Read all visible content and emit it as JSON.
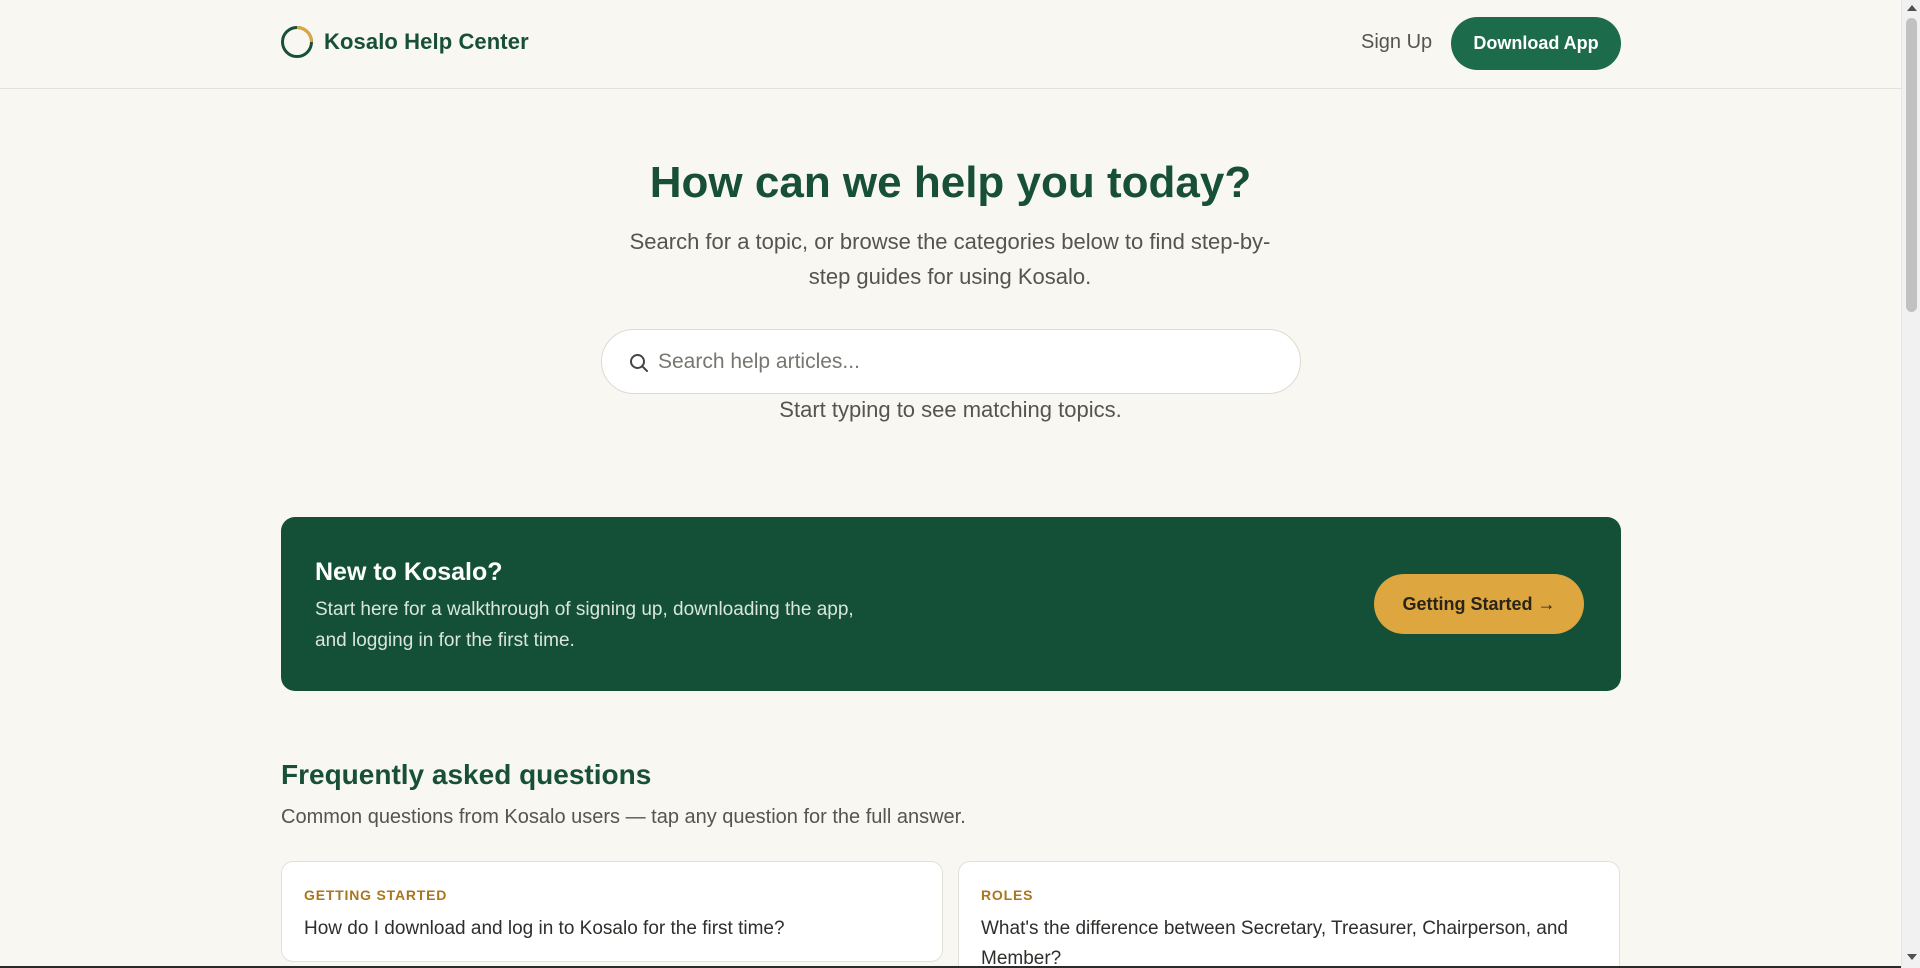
{
  "header": {
    "brand": "Kosalo Help Center",
    "logo_icon": "ring-logo-icon",
    "sign_up_label": "Sign Up",
    "download_label": "Download App"
  },
  "hero": {
    "title": "How can we help you today?",
    "subtitle": "Search for a topic, or browse the categories below to find step-by-step guides for using Kosalo.",
    "search_placeholder": "Search help articles...",
    "search_value": "",
    "search_hint": "Start typing to see matching topics."
  },
  "banner": {
    "title": "New to Kosalo?",
    "text": "Start here for a walkthrough of signing up, downloading the app, and logging in for the first time.",
    "cta_label": "Getting Started →"
  },
  "faq": {
    "title": "Frequently asked questions",
    "subtitle": "Common questions from Kosalo users — tap any question for the full answer.",
    "items": [
      {
        "category": "GETTING STARTED",
        "question": "How do I download and log in to Kosalo for the first time?"
      },
      {
        "category": "ROLES",
        "question": "What's the difference between Secretary, Treasurer, Chairperson, and Member?"
      }
    ]
  },
  "colors": {
    "brand_green": "#174f37",
    "button_green": "#1c6b4a",
    "banner_green": "#144f37",
    "accent_gold": "#dda63f",
    "category_gold": "#a9761e",
    "background": "#f8f7f2"
  }
}
